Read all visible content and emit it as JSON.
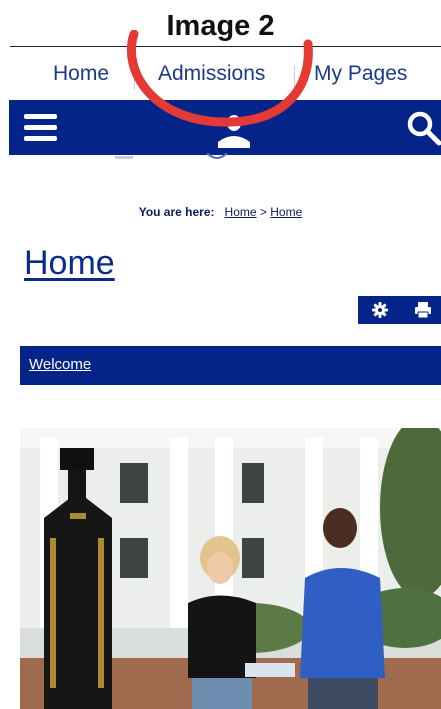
{
  "caption": "Image 2",
  "top_nav": {
    "items": [
      "Home",
      "Admissions",
      "My Pages"
    ]
  },
  "header": {
    "menu_icon": "hamburger-menu-icon",
    "logo": "hawk-mascot-logo",
    "search_icon": "search-icon"
  },
  "breadcrumb": {
    "label": "You are here:",
    "links": [
      "Home",
      "Home"
    ],
    "separator": ">"
  },
  "page": {
    "title": "Home"
  },
  "tools": {
    "icons": [
      "gear-icon",
      "printer-icon"
    ]
  },
  "section": {
    "welcome_link": "Welcome"
  },
  "colors": {
    "brand_blue": "#05248a",
    "annotation_red": "#e53935"
  }
}
